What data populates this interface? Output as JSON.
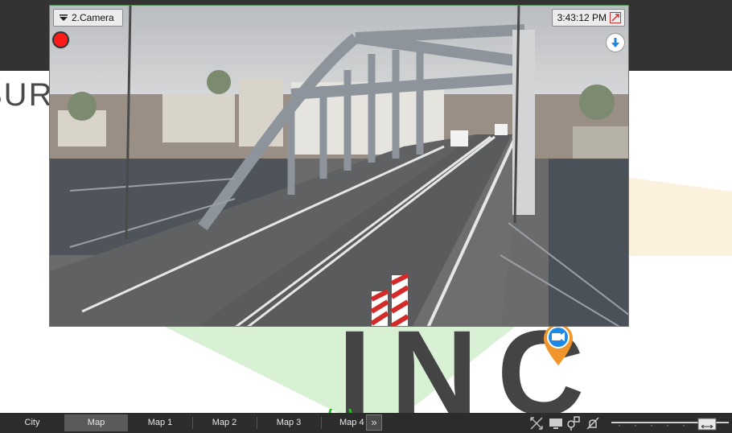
{
  "camera": {
    "name": "2.Camera",
    "time": "3:43:12 PM"
  },
  "map": {
    "logo_text": "SURC",
    "watermark": "INC"
  },
  "tabs": [
    {
      "label": "City",
      "active": false
    },
    {
      "label": "Map",
      "active": true
    },
    {
      "label": "Map 1",
      "active": false
    },
    {
      "label": "Map 2",
      "active": false
    },
    {
      "label": "Map 3",
      "active": false
    },
    {
      "label": "Map 4",
      "active": false
    }
  ],
  "more_tabs_label": "»",
  "colors": {
    "recording": "#ff1a1a",
    "camera_pin": "#f0952c",
    "camera_pin_badge": "#1e88e5",
    "view_cone": "#d8f0d4",
    "frame_border": "#4e8a4e"
  },
  "toolbar_icons": [
    "fullscreen-icon",
    "monitor-icon",
    "layout-icon",
    "mute-icon"
  ]
}
